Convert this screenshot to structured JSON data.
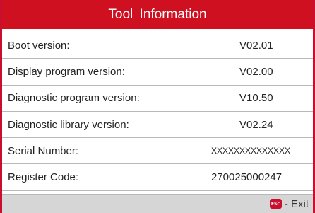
{
  "title": "Tool  Information",
  "rows": [
    {
      "label": "Boot version:",
      "value": "V02.01"
    },
    {
      "label": "Display program version:",
      "value": "V02.00"
    },
    {
      "label": "Diagnostic program version:",
      "value": "V10.50"
    },
    {
      "label": "Diagnostic library version:",
      "value": "V02.24"
    },
    {
      "label": "Serial Number:",
      "value": "XXXXXXXXXXXXXX"
    },
    {
      "label": "Register Code:",
      "value": "270025000247"
    }
  ],
  "footer": {
    "esc_key_label": "ESC",
    "exit_label": "- Exit"
  }
}
